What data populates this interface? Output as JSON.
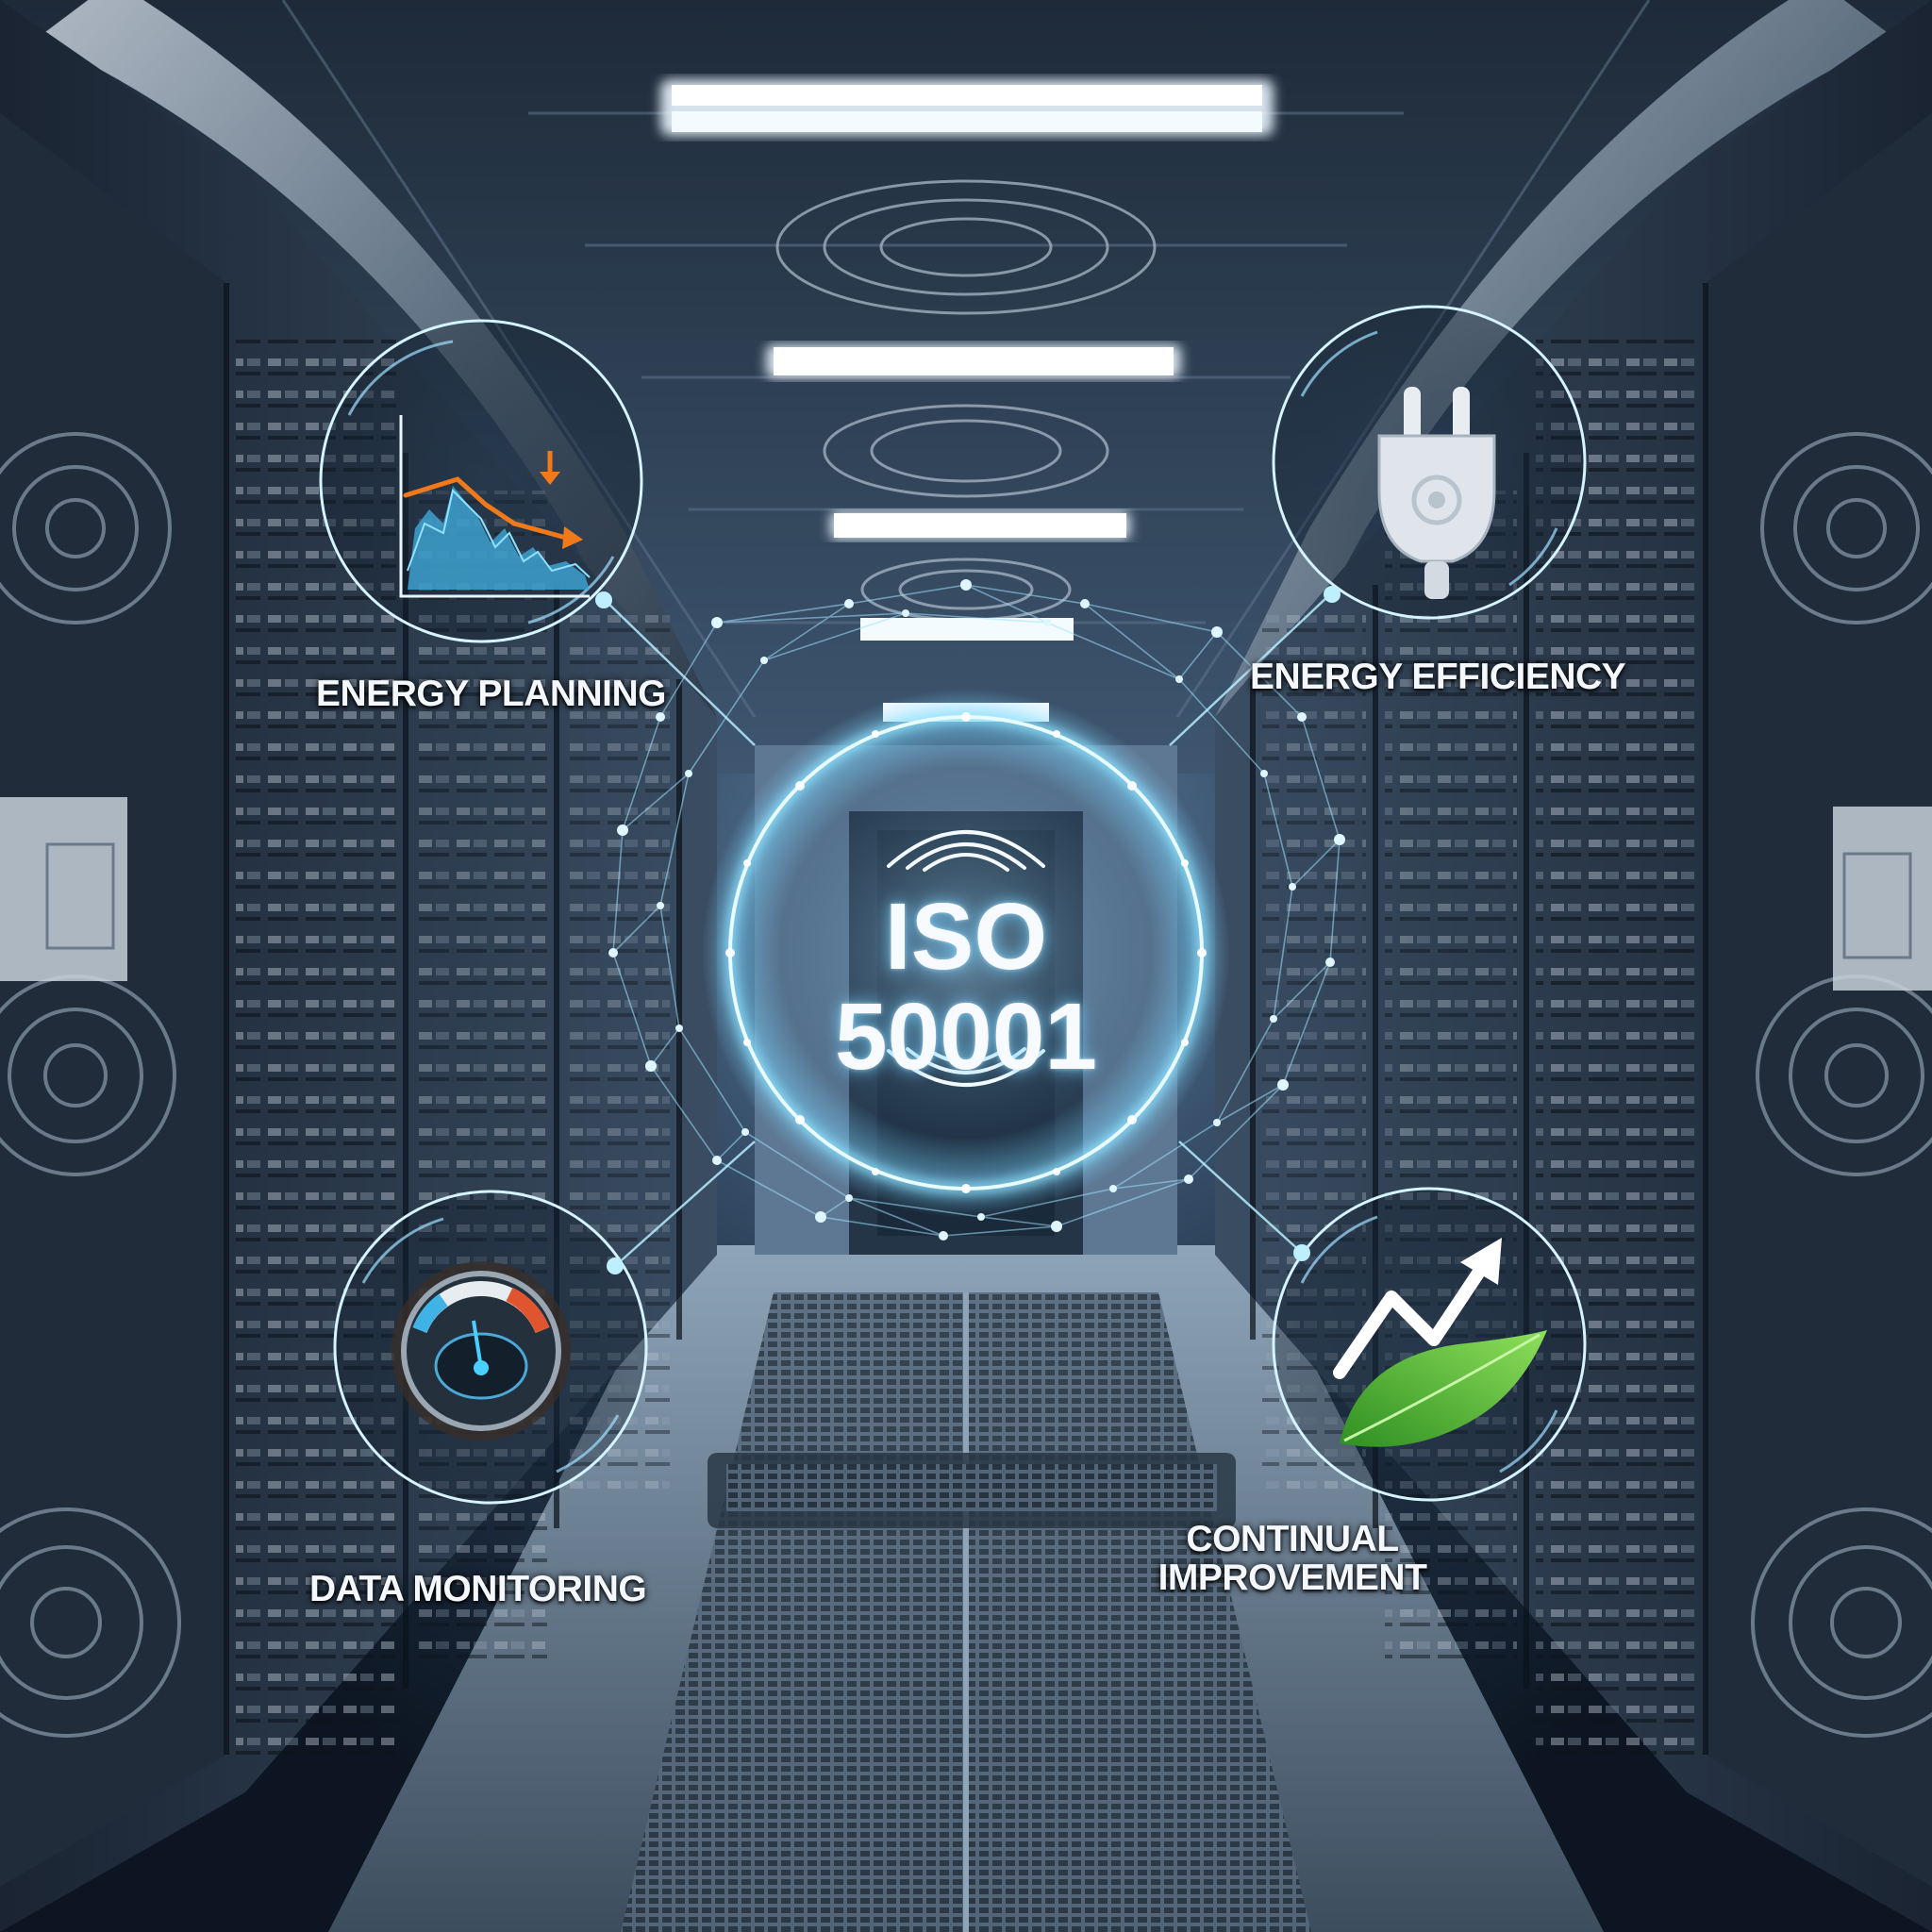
{
  "center_badge": {
    "line1": "ISO",
    "line2": "50001"
  },
  "nodes": [
    {
      "label": "ENERGY PLANNING",
      "icon": "declining-chart-icon"
    },
    {
      "label": "ENERGY EFFICIENCY",
      "icon": "power-plug-icon"
    },
    {
      "label": "DATA MONITORING",
      "icon": "gauge-dial-icon"
    },
    {
      "label": "CONTINUAL",
      "label2": "IMPROVEMENT",
      "icon": "leaf-growth-arrow-icon"
    }
  ],
  "colors": {
    "glow": "#7fd8ff",
    "accent_orange": "#f07a1a",
    "leaf_green": "#5cc23a",
    "background": "#0e1826"
  }
}
